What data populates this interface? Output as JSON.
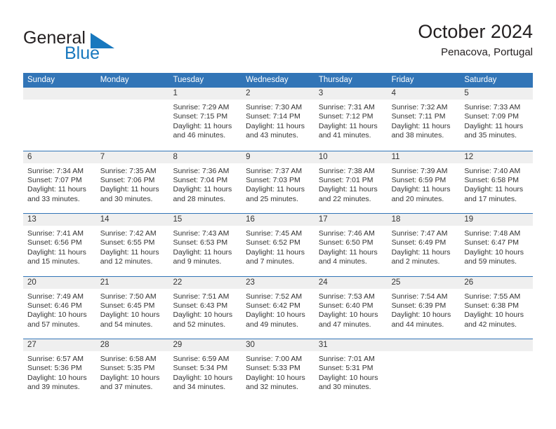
{
  "brand": {
    "line1": "General",
    "line2": "Blue",
    "triangle_icon": "triangle-logo-icon",
    "accent_color": "#1878be"
  },
  "header": {
    "title": "October 2024",
    "subtitle": "Penacova, Portugal"
  },
  "theme": {
    "header_blue": "#3275b7",
    "daynum_bg": "#efefef",
    "text": "#333333"
  },
  "calendar": {
    "weekday_headers": [
      "Sunday",
      "Monday",
      "Tuesday",
      "Wednesday",
      "Thursday",
      "Friday",
      "Saturday"
    ],
    "weeks": [
      [
        {
          "day": "",
          "sunrise": "",
          "sunset": "",
          "daylight": "",
          "empty": true
        },
        {
          "day": "",
          "sunrise": "",
          "sunset": "",
          "daylight": "",
          "empty": true
        },
        {
          "day": "1",
          "sunrise": "Sunrise: 7:29 AM",
          "sunset": "Sunset: 7:15 PM",
          "daylight": "Daylight: 11 hours and 46 minutes."
        },
        {
          "day": "2",
          "sunrise": "Sunrise: 7:30 AM",
          "sunset": "Sunset: 7:14 PM",
          "daylight": "Daylight: 11 hours and 43 minutes."
        },
        {
          "day": "3",
          "sunrise": "Sunrise: 7:31 AM",
          "sunset": "Sunset: 7:12 PM",
          "daylight": "Daylight: 11 hours and 41 minutes."
        },
        {
          "day": "4",
          "sunrise": "Sunrise: 7:32 AM",
          "sunset": "Sunset: 7:11 PM",
          "daylight": "Daylight: 11 hours and 38 minutes."
        },
        {
          "day": "5",
          "sunrise": "Sunrise: 7:33 AM",
          "sunset": "Sunset: 7:09 PM",
          "daylight": "Daylight: 11 hours and 35 minutes."
        }
      ],
      [
        {
          "day": "6",
          "sunrise": "Sunrise: 7:34 AM",
          "sunset": "Sunset: 7:07 PM",
          "daylight": "Daylight: 11 hours and 33 minutes."
        },
        {
          "day": "7",
          "sunrise": "Sunrise: 7:35 AM",
          "sunset": "Sunset: 7:06 PM",
          "daylight": "Daylight: 11 hours and 30 minutes."
        },
        {
          "day": "8",
          "sunrise": "Sunrise: 7:36 AM",
          "sunset": "Sunset: 7:04 PM",
          "daylight": "Daylight: 11 hours and 28 minutes."
        },
        {
          "day": "9",
          "sunrise": "Sunrise: 7:37 AM",
          "sunset": "Sunset: 7:03 PM",
          "daylight": "Daylight: 11 hours and 25 minutes."
        },
        {
          "day": "10",
          "sunrise": "Sunrise: 7:38 AM",
          "sunset": "Sunset: 7:01 PM",
          "daylight": "Daylight: 11 hours and 22 minutes."
        },
        {
          "day": "11",
          "sunrise": "Sunrise: 7:39 AM",
          "sunset": "Sunset: 6:59 PM",
          "daylight": "Daylight: 11 hours and 20 minutes."
        },
        {
          "day": "12",
          "sunrise": "Sunrise: 7:40 AM",
          "sunset": "Sunset: 6:58 PM",
          "daylight": "Daylight: 11 hours and 17 minutes."
        }
      ],
      [
        {
          "day": "13",
          "sunrise": "Sunrise: 7:41 AM",
          "sunset": "Sunset: 6:56 PM",
          "daylight": "Daylight: 11 hours and 15 minutes."
        },
        {
          "day": "14",
          "sunrise": "Sunrise: 7:42 AM",
          "sunset": "Sunset: 6:55 PM",
          "daylight": "Daylight: 11 hours and 12 minutes."
        },
        {
          "day": "15",
          "sunrise": "Sunrise: 7:43 AM",
          "sunset": "Sunset: 6:53 PM",
          "daylight": "Daylight: 11 hours and 9 minutes."
        },
        {
          "day": "16",
          "sunrise": "Sunrise: 7:45 AM",
          "sunset": "Sunset: 6:52 PM",
          "daylight": "Daylight: 11 hours and 7 minutes."
        },
        {
          "day": "17",
          "sunrise": "Sunrise: 7:46 AM",
          "sunset": "Sunset: 6:50 PM",
          "daylight": "Daylight: 11 hours and 4 minutes."
        },
        {
          "day": "18",
          "sunrise": "Sunrise: 7:47 AM",
          "sunset": "Sunset: 6:49 PM",
          "daylight": "Daylight: 11 hours and 2 minutes."
        },
        {
          "day": "19",
          "sunrise": "Sunrise: 7:48 AM",
          "sunset": "Sunset: 6:47 PM",
          "daylight": "Daylight: 10 hours and 59 minutes."
        }
      ],
      [
        {
          "day": "20",
          "sunrise": "Sunrise: 7:49 AM",
          "sunset": "Sunset: 6:46 PM",
          "daylight": "Daylight: 10 hours and 57 minutes."
        },
        {
          "day": "21",
          "sunrise": "Sunrise: 7:50 AM",
          "sunset": "Sunset: 6:45 PM",
          "daylight": "Daylight: 10 hours and 54 minutes."
        },
        {
          "day": "22",
          "sunrise": "Sunrise: 7:51 AM",
          "sunset": "Sunset: 6:43 PM",
          "daylight": "Daylight: 10 hours and 52 minutes."
        },
        {
          "day": "23",
          "sunrise": "Sunrise: 7:52 AM",
          "sunset": "Sunset: 6:42 PM",
          "daylight": "Daylight: 10 hours and 49 minutes."
        },
        {
          "day": "24",
          "sunrise": "Sunrise: 7:53 AM",
          "sunset": "Sunset: 6:40 PM",
          "daylight": "Daylight: 10 hours and 47 minutes."
        },
        {
          "day": "25",
          "sunrise": "Sunrise: 7:54 AM",
          "sunset": "Sunset: 6:39 PM",
          "daylight": "Daylight: 10 hours and 44 minutes."
        },
        {
          "day": "26",
          "sunrise": "Sunrise: 7:55 AM",
          "sunset": "Sunset: 6:38 PM",
          "daylight": "Daylight: 10 hours and 42 minutes."
        }
      ],
      [
        {
          "day": "27",
          "sunrise": "Sunrise: 6:57 AM",
          "sunset": "Sunset: 5:36 PM",
          "daylight": "Daylight: 10 hours and 39 minutes."
        },
        {
          "day": "28",
          "sunrise": "Sunrise: 6:58 AM",
          "sunset": "Sunset: 5:35 PM",
          "daylight": "Daylight: 10 hours and 37 minutes."
        },
        {
          "day": "29",
          "sunrise": "Sunrise: 6:59 AM",
          "sunset": "Sunset: 5:34 PM",
          "daylight": "Daylight: 10 hours and 34 minutes."
        },
        {
          "day": "30",
          "sunrise": "Sunrise: 7:00 AM",
          "sunset": "Sunset: 5:33 PM",
          "daylight": "Daylight: 10 hours and 32 minutes."
        },
        {
          "day": "31",
          "sunrise": "Sunrise: 7:01 AM",
          "sunset": "Sunset: 5:31 PM",
          "daylight": "Daylight: 10 hours and 30 minutes."
        },
        {
          "day": "",
          "sunrise": "",
          "sunset": "",
          "daylight": "",
          "empty": true
        },
        {
          "day": "",
          "sunrise": "",
          "sunset": "",
          "daylight": "",
          "empty": true
        }
      ]
    ]
  }
}
